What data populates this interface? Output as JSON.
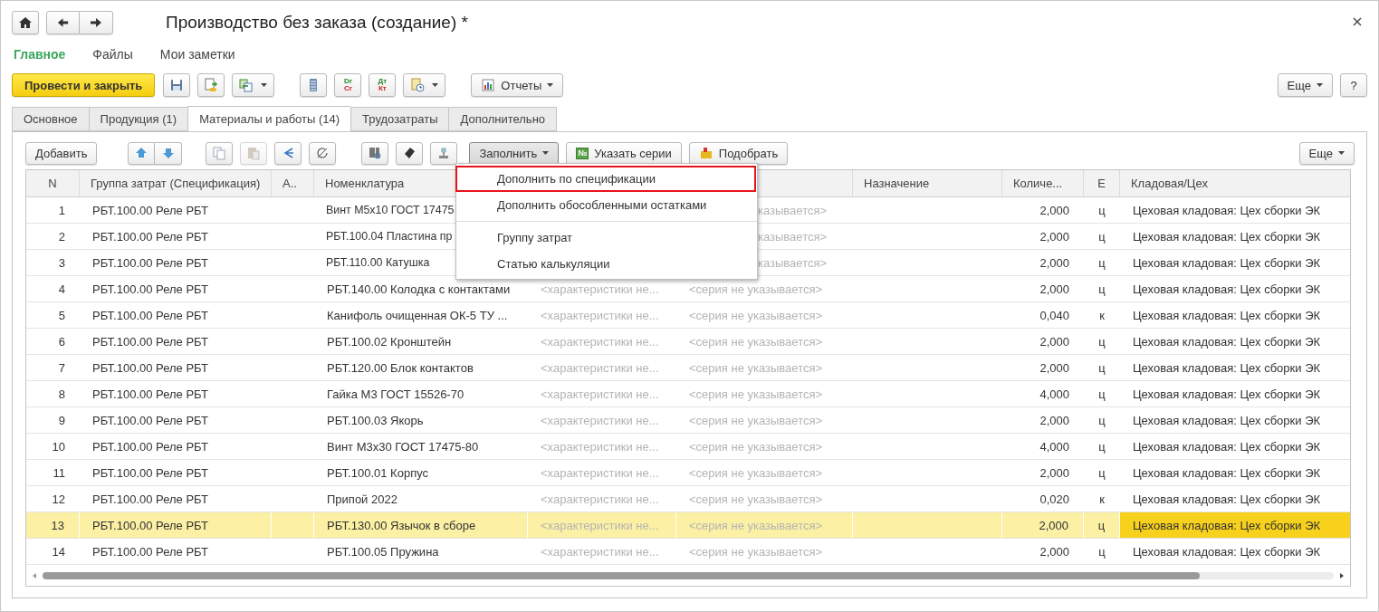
{
  "window": {
    "title": "Производство без заказа (создание) *"
  },
  "nav": [
    {
      "label": "Главное",
      "selected": true
    },
    {
      "label": "Файлы",
      "selected": false
    },
    {
      "label": "Мои заметки",
      "selected": false
    }
  ],
  "toolbar": {
    "primary": "Провести и закрыть",
    "dr_cr": [
      "Dr",
      "Cr"
    ],
    "dt_kt": [
      "Дт",
      "Кт"
    ],
    "reports": "Отчеты",
    "more": "Еще",
    "help": "?"
  },
  "tabs": [
    {
      "label": "Основное",
      "selected": false
    },
    {
      "label": "Продукция (1)",
      "selected": false
    },
    {
      "label": "Материалы и работы (14)",
      "selected": true
    },
    {
      "label": "Трудозатраты",
      "selected": false
    },
    {
      "label": "Дополнительно",
      "selected": false
    }
  ],
  "table_toolbar": {
    "add": "Добавить",
    "fill": "Заполнить",
    "series_mark": "№",
    "series": "Указать серии",
    "pick": "Подобрать",
    "more": "Еще"
  },
  "fill_menu": {
    "groups": [
      {
        "items": [
          {
            "label": "Дополнить по спецификации",
            "selected": true
          },
          {
            "label": "Дополнить обособленными остатками",
            "selected": false
          }
        ]
      },
      {
        "items": [
          {
            "label": "Группу затрат",
            "selected": false
          },
          {
            "label": "Статью калькуляции",
            "selected": false
          }
        ]
      }
    ]
  },
  "table": {
    "columns": [
      {
        "label": "N"
      },
      {
        "label": "Группа затрат (Спецификация)"
      },
      {
        "label": "А.."
      },
      {
        "label": "Номенклатура"
      },
      {},
      {},
      {
        "label": "Назначение"
      },
      {
        "label": "Количе..."
      },
      {
        "label": "Е"
      },
      {
        "label": "Кладовая/Цех"
      }
    ],
    "rows": [
      {
        "n": "1",
        "group": "РБТ.100.00 Реле РБТ",
        "item": "Винт М5х10 ГОСТ 17475",
        "series": "казывается>",
        "under_menu": true,
        "qty": "2,000",
        "unit": "ц",
        "store": "Цеховая кладовая: Цех сборки ЭК",
        "selected": false
      },
      {
        "n": "2",
        "group": "РБТ.100.00 Реле РБТ",
        "item": "РБТ.100.04 Пластина пр",
        "series": "казывается>",
        "under_menu": true,
        "qty": "2,000",
        "unit": "ц",
        "store": "Цеховая кладовая: Цех сборки ЭК",
        "selected": false
      },
      {
        "n": "3",
        "group": "РБТ.100.00 Реле РБТ",
        "item": "РБТ.110.00 Катушка",
        "series": "казывается>",
        "under_menu": true,
        "qty": "2,000",
        "unit": "ц",
        "store": "Цеховая кладовая: Цех сборки ЭК",
        "selected": false
      },
      {
        "n": "4",
        "group": "РБТ.100.00 Реле РБТ",
        "item": "РБТ.140.00 Колодка с контактами",
        "characteristic": "<характеристики не...",
        "series": "<серия не указывается>",
        "under_menu": false,
        "qty": "2,000",
        "unit": "ц",
        "store": "Цеховая кладовая: Цех сборки ЭК",
        "selected": false
      },
      {
        "n": "5",
        "group": "РБТ.100.00 Реле РБТ",
        "item": "Канифоль очищенная ОК-5 ТУ ...",
        "characteristic": "<характеристики не...",
        "series": "<серия не указывается>",
        "under_menu": false,
        "qty": "0,040",
        "unit": "к",
        "store": "Цеховая кладовая: Цех сборки ЭК",
        "selected": false
      },
      {
        "n": "6",
        "group": "РБТ.100.00 Реле РБТ",
        "item": "РБТ.100.02 Кронштейн",
        "characteristic": "<характеристики не...",
        "series": "<серия не указывается>",
        "under_menu": false,
        "qty": "2,000",
        "unit": "ц",
        "store": "Цеховая кладовая: Цех сборки ЭК",
        "selected": false
      },
      {
        "n": "7",
        "group": "РБТ.100.00 Реле РБТ",
        "item": "РБТ.120.00 Блок контактов",
        "characteristic": "<характеристики не...",
        "series": "<серия не указывается>",
        "under_menu": false,
        "qty": "2,000",
        "unit": "ц",
        "store": "Цеховая кладовая: Цех сборки ЭК",
        "selected": false
      },
      {
        "n": "8",
        "group": "РБТ.100.00 Реле РБТ",
        "item": "Гайка М3 ГОСТ 15526-70",
        "characteristic": "<характеристики не...",
        "series": "<серия не указывается>",
        "under_menu": false,
        "qty": "4,000",
        "unit": "ц",
        "store": "Цеховая кладовая: Цех сборки ЭК",
        "selected": false
      },
      {
        "n": "9",
        "group": "РБТ.100.00 Реле РБТ",
        "item": "РБТ.100.03 Якорь",
        "characteristic": "<характеристики не...",
        "series": "<серия не указывается>",
        "under_menu": false,
        "qty": "2,000",
        "unit": "ц",
        "store": "Цеховая кладовая: Цех сборки ЭК",
        "selected": false
      },
      {
        "n": "10",
        "group": "РБТ.100.00 Реле РБТ",
        "item": "Винт М3х30 ГОСТ 17475-80",
        "characteristic": "<характеристики не...",
        "series": "<серия не указывается>",
        "under_menu": false,
        "qty": "4,000",
        "unit": "ц",
        "store": "Цеховая кладовая: Цех сборки ЭК",
        "selected": false
      },
      {
        "n": "11",
        "group": "РБТ.100.00 Реле РБТ",
        "item": "РБТ.100.01 Корпус",
        "characteristic": "<характеристики не...",
        "series": "<серия не указывается>",
        "under_menu": false,
        "qty": "2,000",
        "unit": "ц",
        "store": "Цеховая кладовая: Цех сборки ЭК",
        "selected": false
      },
      {
        "n": "12",
        "group": "РБТ.100.00 Реле РБТ",
        "item": "Припой 2022",
        "characteristic": "<характеристики не...",
        "series": "<серия не указывается>",
        "under_menu": false,
        "qty": "0,020",
        "unit": "к",
        "store": "Цеховая кладовая: Цех сборки ЭК",
        "selected": false
      },
      {
        "n": "13",
        "group": "РБТ.100.00 Реле РБТ",
        "item": "РБТ.130.00 Язычок в сборе",
        "characteristic": "<характеристики не...",
        "series": "<серия не указывается>",
        "under_menu": false,
        "qty": "2,000",
        "unit": "ц",
        "store": "Цеховая кладовая: Цех сборки ЭК",
        "selected": true
      },
      {
        "n": "14",
        "group": "РБТ.100.00 Реле РБТ",
        "item": "РБТ.100.05 Пружина",
        "characteristic": "<характеристики не...",
        "series": "<серия не указывается>",
        "under_menu": false,
        "qty": "2,000",
        "unit": "ц",
        "store": "Цеховая кладовая: Цех сборки ЭК",
        "selected": false
      }
    ]
  }
}
